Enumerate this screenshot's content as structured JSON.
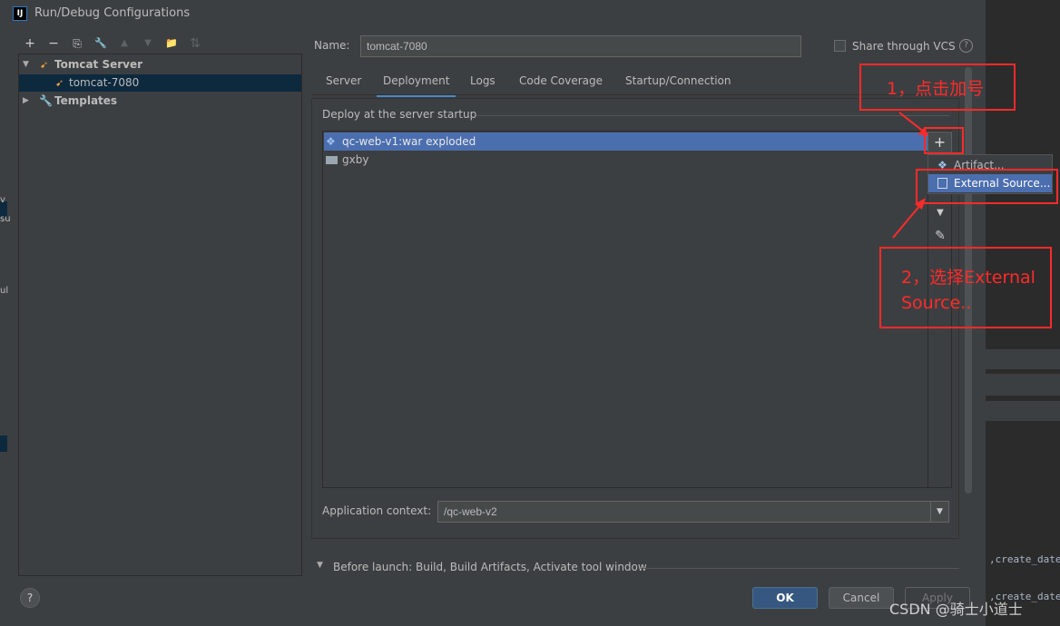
{
  "window": {
    "title": "Run/Debug Configurations",
    "logo_text": "IJ"
  },
  "toolbar": {
    "add": "+",
    "remove": "−",
    "copy": "⎘",
    "edit": "🔧",
    "up": "▲",
    "down": "▼",
    "folder": "📁",
    "sort": "⇅"
  },
  "tree": {
    "items": [
      {
        "label": "Tomcat Server",
        "arrow": "▼",
        "icon": "tomcat-icon"
      },
      {
        "label": "tomcat-7080",
        "icon": "tomcat-icon"
      },
      {
        "label": "Templates",
        "arrow": "▶",
        "icon": "wrench-icon"
      }
    ]
  },
  "name_field": {
    "label": "Name:",
    "value": "tomcat-7080"
  },
  "share": {
    "label": "Share through VCS",
    "help": "?"
  },
  "tabs": [
    "Server",
    "Deployment",
    "Logs",
    "Code Coverage",
    "Startup/Connection"
  ],
  "active_tab": "Deployment",
  "deploy": {
    "section_label": "Deploy at the server startup",
    "items": [
      {
        "label": "qc-web-v1:war exploded",
        "icon": "artifact-icon"
      },
      {
        "label": "gxby",
        "icon": "folder-icon"
      }
    ],
    "add_button": "+",
    "move_down": "▼",
    "edit": "✎"
  },
  "popup": {
    "items": [
      "Artifact...",
      "External Source..."
    ]
  },
  "app_context": {
    "label": "Application context:",
    "value": "/qc-web-v2"
  },
  "before_launch": "Before launch: Build, Build Artifacts, Activate tool window",
  "buttons": {
    "ok": "OK",
    "cancel": "Cancel",
    "apply": "Apply",
    "help": "?"
  },
  "annotations": {
    "step1": "1，点击加号",
    "step2_line1": "2，选择External",
    "step2_line2": "Source.."
  },
  "background": {
    "code1": ",create_date",
    "code2": ",create_date",
    "watermark": "CSDN @骑士小道士",
    "left_a": "v",
    "left_b": "su",
    "left_c": "ul"
  },
  "colors": {
    "selection": "#4b6eaf",
    "annotation": "#ff2a2a",
    "ok_button": "#365880"
  }
}
